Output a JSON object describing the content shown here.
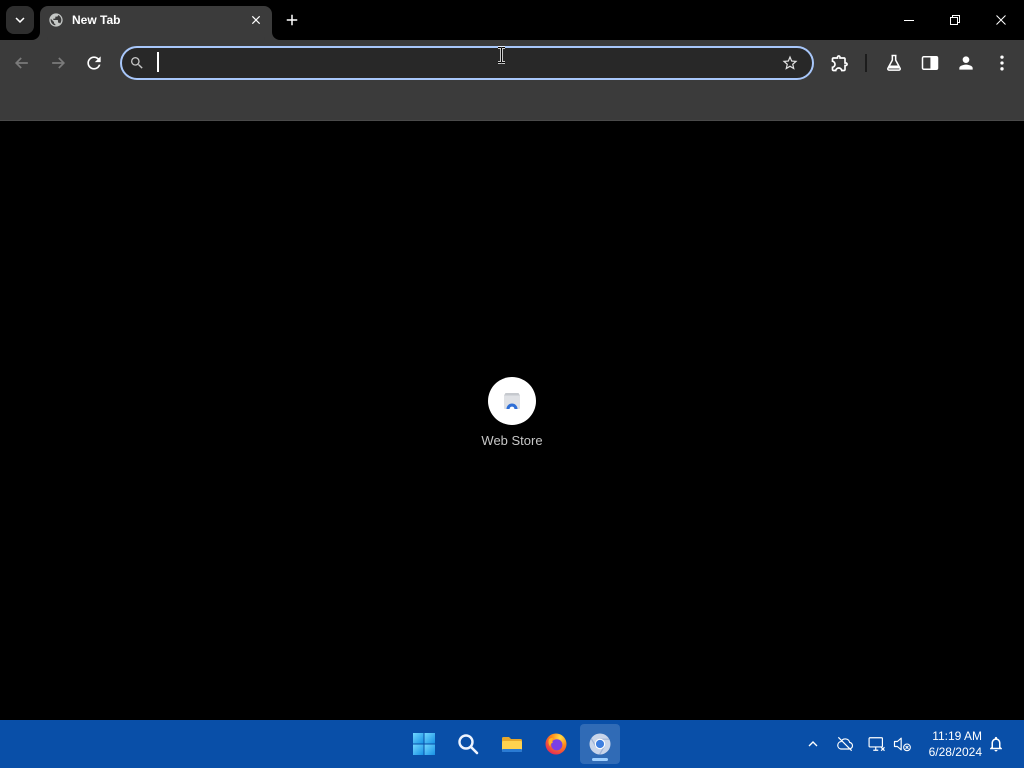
{
  "window": {
    "tab_search_icon": "chevron-down-icon",
    "tabs": [
      {
        "title": "New Tab",
        "favicon": "globe-icon",
        "close_icon": "close-icon"
      }
    ],
    "new_tab_icon": "plus-icon",
    "controls": [
      "minimize-icon",
      "restore-icon",
      "close-icon"
    ]
  },
  "toolbar": {
    "back_icon": "arrow-left-icon",
    "forward_icon": "arrow-right-icon",
    "reload_icon": "reload-icon",
    "omnibox": {
      "leading_icon": "search-icon",
      "value": "",
      "trailing_icon": "star-icon"
    },
    "actions": [
      "extensions-puzzle-icon",
      "labs-beaker-icon",
      "side-panel-icon",
      "profile-icon",
      "more-vert-icon"
    ]
  },
  "new_tab_page": {
    "shortcuts": [
      {
        "label": "Web Store",
        "icon": "chrome-web-store-icon"
      }
    ]
  },
  "taskbar": {
    "pinned_apps": [
      "windows-start-icon",
      "search-icon",
      "file-explorer-icon",
      "firefox-icon",
      "chrome-icon"
    ],
    "active_app": "chrome-icon",
    "tray_icons": [
      "chevron-up-icon",
      "onedrive-offline-icon",
      "network-icon",
      "volume-muted-icon"
    ],
    "clock": {
      "time": "11:19 AM",
      "date": "6/28/2024"
    },
    "notification_icon": "bell-icon"
  },
  "colors": {
    "frame": "#000000",
    "toolbar": "#3b3b3b",
    "omnibox_bg": "#282828",
    "omnibox_focus_ring": "#a8c7fa",
    "page_bg": "#000000",
    "taskbar": "#094fa8",
    "text_primary": "#ffffff",
    "text_secondary": "#c7c7c7",
    "active_indicator": "#9fd0ff"
  }
}
